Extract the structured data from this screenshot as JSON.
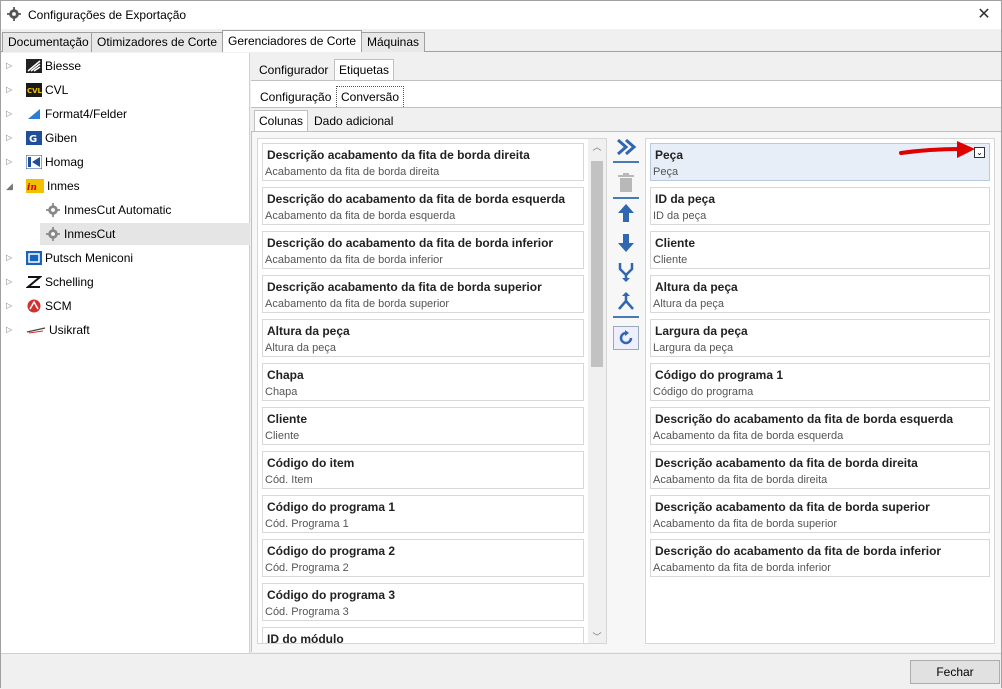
{
  "window": {
    "title": "Configurações de Exportação"
  },
  "top_tabs": [
    {
      "label": "Documentação"
    },
    {
      "label": "Otimizadores de Corte"
    },
    {
      "label": "Gerenciadores de Corte"
    },
    {
      "label": "Máquinas"
    }
  ],
  "tree": [
    {
      "label": "Biesse",
      "icon": "biesse-logo-icon"
    },
    {
      "label": "CVL",
      "icon": "cvl-logo-icon"
    },
    {
      "label": "Format4/Felder",
      "icon": "format4-logo-icon"
    },
    {
      "label": "Giben",
      "icon": "giben-logo-icon"
    },
    {
      "label": "Homag",
      "icon": "homag-logo-icon"
    },
    {
      "label": "Inmes",
      "icon": "inmes-logo-icon"
    },
    {
      "label": "InmesCut Automatic",
      "icon": "gear-icon"
    },
    {
      "label": "InmesCut",
      "icon": "gear-icon"
    },
    {
      "label": "Putsch Meniconi",
      "icon": "putsch-logo-icon"
    },
    {
      "label": "Schelling",
      "icon": "schelling-logo-icon"
    },
    {
      "label": "SCM",
      "icon": "scm-logo-icon"
    },
    {
      "label": "Usikraft",
      "icon": "usikraft-logo-icon"
    }
  ],
  "tabs_level1": [
    {
      "label": "Configurador"
    },
    {
      "label": "Etiquetas"
    }
  ],
  "tabs_level2": [
    {
      "label": "Configuração"
    },
    {
      "label": "Conversão"
    }
  ],
  "tabs_level3": [
    {
      "label": "Colunas"
    },
    {
      "label": "Dado adicional"
    }
  ],
  "available_columns": [
    {
      "title": "Descrição acabamento da fita de borda direita",
      "sub": "Acabamento da fita de borda direita"
    },
    {
      "title": "Descrição do acabamento da fita de borda esquerda",
      "sub": "Acabamento da fita de borda esquerda"
    },
    {
      "title": "Descrição do acabamento da fita de borda inferior",
      "sub": "Acabamento da fita de borda inferior"
    },
    {
      "title": "Descrição acabamento da fita de borda superior",
      "sub": "Acabamento da fita de borda superior"
    },
    {
      "title": "Altura da peça",
      "sub": "Altura da peça"
    },
    {
      "title": "Chapa",
      "sub": "Chapa"
    },
    {
      "title": "Cliente",
      "sub": "Cliente"
    },
    {
      "title": "Código do item",
      "sub": "Cód. Item"
    },
    {
      "title": "Código do programa 1",
      "sub": "Cód. Programa 1"
    },
    {
      "title": "Código do programa 2",
      "sub": "Cód. Programa 2"
    },
    {
      "title": "Código do programa 3",
      "sub": "Cód. Programa 3"
    },
    {
      "title": "ID do módulo",
      "sub": ""
    }
  ],
  "selected_columns": [
    {
      "title": "Peça",
      "sub": "Peça"
    },
    {
      "title": "ID da peça",
      "sub": "ID da peça"
    },
    {
      "title": "Cliente",
      "sub": "Cliente"
    },
    {
      "title": "Altura da peça",
      "sub": "Altura da peça"
    },
    {
      "title": "Largura da peça",
      "sub": "Largura da peça"
    },
    {
      "title": "Código do programa 1",
      "sub": "Código do programa"
    },
    {
      "title": "Descrição do acabamento da fita de borda esquerda",
      "sub": "Acabamento da fita de borda esquerda"
    },
    {
      "title": "Descrição acabamento da fita de borda direita",
      "sub": "Acabamento da fita de borda direita"
    },
    {
      "title": "Descrição acabamento da fita de borda superior",
      "sub": "Acabamento da fita de borda superior"
    },
    {
      "title": "Descrição do acabamento da fita de borda inferior",
      "sub": "Acabamento da fita de borda inferior"
    }
  ],
  "toolbar_icons": [
    "move-all-right-icon",
    "delete-icon",
    "move-up-icon",
    "move-down-icon",
    "merge-icon",
    "split-icon",
    "refresh-icon"
  ],
  "footer": {
    "close_label": "Fechar"
  },
  "colors": {
    "accent": "#2f67b0",
    "annotation_arrow": "#e00000"
  }
}
